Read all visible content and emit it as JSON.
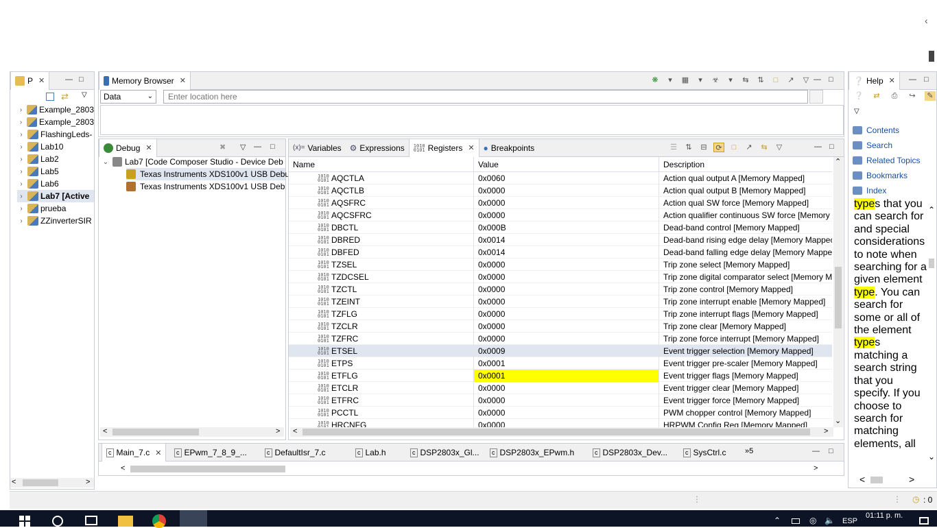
{
  "project_explorer": {
    "tab_label": "P",
    "items": [
      {
        "label": "Example_2803",
        "bold": false
      },
      {
        "label": "Example_2803",
        "bold": false
      },
      {
        "label": "FlashingLeds-",
        "bold": false
      },
      {
        "label": "Lab10",
        "bold": false
      },
      {
        "label": "Lab2",
        "bold": false
      },
      {
        "label": "Lab5",
        "bold": false
      },
      {
        "label": "Lab6",
        "bold": false
      },
      {
        "label": "Lab7  [Active",
        "bold": true
      },
      {
        "label": "prueba",
        "bold": false
      },
      {
        "label": "ZZinverterSIR",
        "bold": false
      }
    ]
  },
  "memory_browser": {
    "tab_label": "Memory Browser",
    "type_select": "Data",
    "location_placeholder": "Enter location here"
  },
  "debug": {
    "tab_label": "Debug",
    "session": "Lab7 [Code Composer Studio - Device Deb",
    "targets": [
      "Texas Instruments XDS100v1 USB Debug",
      "Texas Instruments XDS100v1 USB Debug"
    ]
  },
  "registers_view": {
    "tabs": [
      "Variables",
      "Expressions",
      "Registers",
      "Breakpoints"
    ],
    "tab_prefix": "(x)=",
    "columns": [
      "Name",
      "Value",
      "Description"
    ],
    "highlight_color": "#ffff00",
    "rows": [
      {
        "name": "AQCTLA",
        "value": "0x0060",
        "desc": "Action qual output A [Memory Mapped]"
      },
      {
        "name": "AQCTLB",
        "value": "0x0000",
        "desc": "Action qual output B [Memory Mapped]"
      },
      {
        "name": "AQSFRC",
        "value": "0x0000",
        "desc": "Action qual SW force [Memory Mapped]"
      },
      {
        "name": "AQCSFRC",
        "value": "0x0000",
        "desc": "Action qualifier continuous SW force [Memory"
      },
      {
        "name": "DBCTL",
        "value": "0x000B",
        "desc": "Dead-band control [Memory Mapped]"
      },
      {
        "name": "DBRED",
        "value": "0x0014",
        "desc": "Dead-band rising edge delay [Memory Mappec"
      },
      {
        "name": "DBFED",
        "value": "0x0014",
        "desc": "Dead-band falling edge delay [Memory Mappe"
      },
      {
        "name": "TZSEL",
        "value": "0x0000",
        "desc": "Trip zone select [Memory Mapped]"
      },
      {
        "name": "TZDCSEL",
        "value": "0x0000",
        "desc": "Trip zone digital comparator select [Memory M"
      },
      {
        "name": "TZCTL",
        "value": "0x0000",
        "desc": "Trip zone control [Memory Mapped]"
      },
      {
        "name": "TZEINT",
        "value": "0x0000",
        "desc": "Trip zone interrupt enable [Memory Mapped]"
      },
      {
        "name": "TZFLG",
        "value": "0x0000",
        "desc": "Trip zone interrupt flags [Memory Mapped]"
      },
      {
        "name": "TZCLR",
        "value": "0x0000",
        "desc": "Trip zone clear [Memory Mapped]"
      },
      {
        "name": "TZFRC",
        "value": "0x0000",
        "desc": "Trip zone force interrupt [Memory Mapped]"
      },
      {
        "name": "ETSEL",
        "value": "0x0009",
        "desc": "Event trigger selection [Memory Mapped]",
        "selected": true
      },
      {
        "name": "ETPS",
        "value": "0x0001",
        "desc": "Event trigger pre-scaler [Memory Mapped]"
      },
      {
        "name": "ETFLG",
        "value": "0x0001",
        "desc": "Event trigger flags [Memory Mapped]",
        "changed": true
      },
      {
        "name": "ETCLR",
        "value": "0x0000",
        "desc": "Event trigger clear [Memory Mapped]"
      },
      {
        "name": "ETFRC",
        "value": "0x0000",
        "desc": "Event trigger force [Memory Mapped]"
      },
      {
        "name": "PCCTL",
        "value": "0x0000",
        "desc": "PWM chopper control [Memory Mapped]"
      },
      {
        "name": "HRCNFG",
        "value": "0x0000",
        "desc": "HRPWM Config Reg [Memory Mapped]"
      }
    ]
  },
  "help": {
    "tab_label": "Help",
    "links": [
      "Contents",
      "Search",
      "Related Topics",
      "Bookmarks",
      "Index"
    ],
    "text_parts": [
      {
        "t": "type",
        "hl": true
      },
      {
        "t": "s that you can search for and special considerations to note when searching for a given element ",
        "hl": false
      },
      {
        "t": "type",
        "hl": true
      },
      {
        "t": ". You can search for some or all of the element ",
        "hl": false
      },
      {
        "t": "type",
        "hl": true
      },
      {
        "t": "s matching a search string that you specify. If you choose to search for matching elements, all",
        "hl": false
      }
    ]
  },
  "editor_tabs": [
    "Main_7.c",
    "EPwm_7_8_9_...",
    "DefaultIsr_7.c",
    "Lab.h",
    "DSP2803x_Gl...",
    "DSP2803x_EPwm.h",
    "DSP2803x_Dev...",
    "SysCtrl.c"
  ],
  "editor_overflow": "»5",
  "status": {
    "clock_readout": ": 0"
  },
  "taskbar": {
    "lang": "ESP",
    "time": "01:11 p. m."
  }
}
